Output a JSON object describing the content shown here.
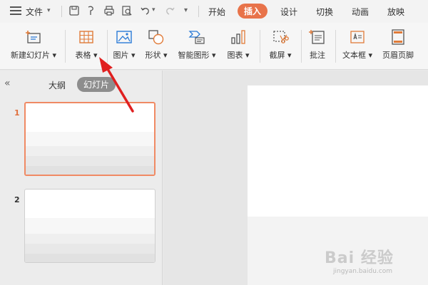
{
  "topbar": {
    "file_label": "文件",
    "tabs": [
      "开始",
      "插入",
      "设计",
      "切换",
      "动画",
      "放映"
    ],
    "active_tab_index": 1,
    "active_color": "#e8734a"
  },
  "ribbon": {
    "new_slide": "新建幻灯片",
    "table": "表格",
    "picture": "图片",
    "shape": "形状",
    "smart_art": "智能图形",
    "chart": "图表",
    "screenshot": "截屏",
    "comment": "批注",
    "textbox": "文本框",
    "header_footer": "页眉页脚"
  },
  "left_panel": {
    "outline_tab": "大纲",
    "slides_tab": "幻灯片",
    "slides": [
      {
        "number": "1",
        "selected": true
      },
      {
        "number": "2",
        "selected": false
      }
    ]
  },
  "watermark": {
    "brand": "Bai 经验",
    "url": "jingyan.baidu.com"
  }
}
